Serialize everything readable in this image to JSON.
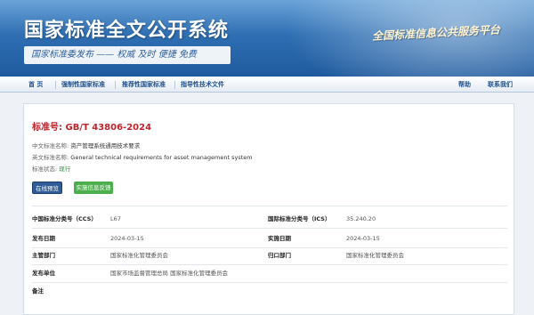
{
  "banner": {
    "title": "国家标准全文公开系统",
    "slogan": "国家标准委发布 —— 权威 及时 便捷 免费",
    "platform": "全国标准信息公共服务平台"
  },
  "nav": {
    "items": [
      {
        "label": "首 页"
      },
      {
        "label": "强制性国家标准"
      },
      {
        "label": "推荐性国家标准"
      },
      {
        "label": "指导性技术文件"
      }
    ],
    "help": "帮助",
    "contact": "联系我们"
  },
  "standard": {
    "number_label": "标准号:",
    "number": "GB/T 43806-2024",
    "cn_name_label": "中文标准名称:",
    "cn_name": "资产管理系统通用技术要求",
    "en_name_label": "英文标准名称:",
    "en_name": "General technical requirements for asset management system",
    "status_label": "标准状态:",
    "status": "现行"
  },
  "buttons": {
    "preview": "在线预览",
    "feedback": "实施信息反馈"
  },
  "details": [
    {
      "k1": "中国标准分类号（CCS）",
      "v1": "L67",
      "k2": "国际标准分类号（ICS）",
      "v2": "35.240.20"
    },
    {
      "k1": "发布日期",
      "v1": "2024-03-15",
      "k2": "实施日期",
      "v2": "2024-03-15"
    },
    {
      "k1": "主管部门",
      "v1": "国家标准化管理委员会",
      "k2": "归口部门",
      "v2": "国家标准化管理委员会"
    },
    {
      "k1": "发布单位",
      "v1": "国家市场监督管理总局 国家标准化管理委员会",
      "k2": "",
      "v2": ""
    },
    {
      "k1": "备注",
      "v1": "",
      "k2": "",
      "v2": ""
    }
  ]
}
